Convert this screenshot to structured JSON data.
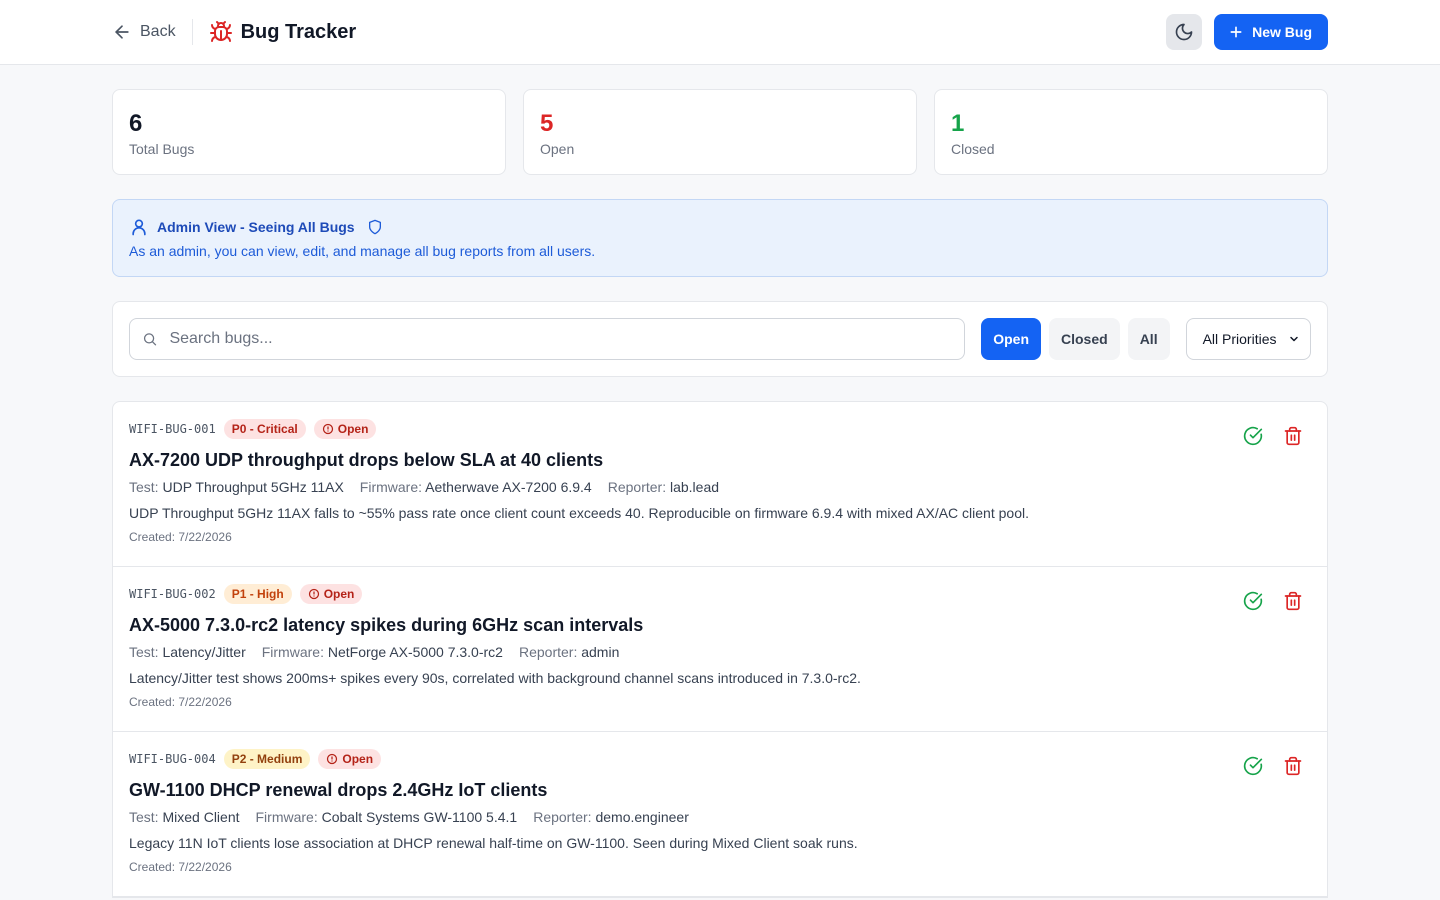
{
  "header": {
    "back_label": "Back",
    "title": "Bug Tracker",
    "new_bug_label": "New Bug"
  },
  "stats": [
    {
      "value": "6",
      "label": "Total Bugs",
      "color": "#111827"
    },
    {
      "value": "5",
      "label": "Open",
      "color": "#dc2626"
    },
    {
      "value": "1",
      "label": "Closed",
      "color": "#16a34a"
    }
  ],
  "admin": {
    "title": "Admin View - Seeing All Bugs",
    "description": "As an admin, you can view, edit, and manage all bug reports from all users."
  },
  "filters": {
    "search_placeholder": "Search bugs...",
    "status_buttons": [
      "Open",
      "Closed",
      "All"
    ],
    "active_status": "Open",
    "priority_selected": "All Priorities"
  },
  "meta_labels": {
    "test": "Test:",
    "firmware": "Firmware:",
    "reporter": "Reporter:"
  },
  "bugs": [
    {
      "id": "WIFI-BUG-001",
      "priority": "P0 - Critical",
      "status": "Open",
      "title": "AX-7200 UDP throughput drops below SLA at 40 clients",
      "test": "UDP Throughput 5GHz 11AX",
      "firmware": "Aetherwave AX-7200 6.9.4",
      "reporter": "lab.lead",
      "description": "UDP Throughput 5GHz 11AX falls to ~55% pass rate once client count exceeds 40. Reproducible on firmware 6.9.4 with mixed AX/AC client pool.",
      "created": "Created: 7/22/2026"
    },
    {
      "id": "WIFI-BUG-002",
      "priority": "P1 - High",
      "status": "Open",
      "title": "AX-5000 7.3.0-rc2 latency spikes during 6GHz scan intervals",
      "test": "Latency/Jitter",
      "firmware": "NetForge AX-5000 7.3.0-rc2",
      "reporter": "admin",
      "description": "Latency/Jitter test shows 200ms+ spikes every 90s, correlated with background channel scans introduced in 7.3.0-rc2.",
      "created": "Created: 7/22/2026"
    },
    {
      "id": "WIFI-BUG-004",
      "priority": "P2 - Medium",
      "status": "Open",
      "title": "GW-1100 DHCP renewal drops 2.4GHz IoT clients",
      "test": "Mixed Client",
      "firmware": "Cobalt Systems GW-1100 5.4.1",
      "reporter": "demo.engineer",
      "description": "Legacy 11N IoT clients lose association at DHCP renewal half-time on GW-1100. Seen during Mixed Client soak runs.",
      "created": "Created: 7/22/2026"
    }
  ],
  "colors": {
    "accent": "#1463f3",
    "resolve_icon": "#16a34a",
    "delete_icon": "#dc2626"
  }
}
